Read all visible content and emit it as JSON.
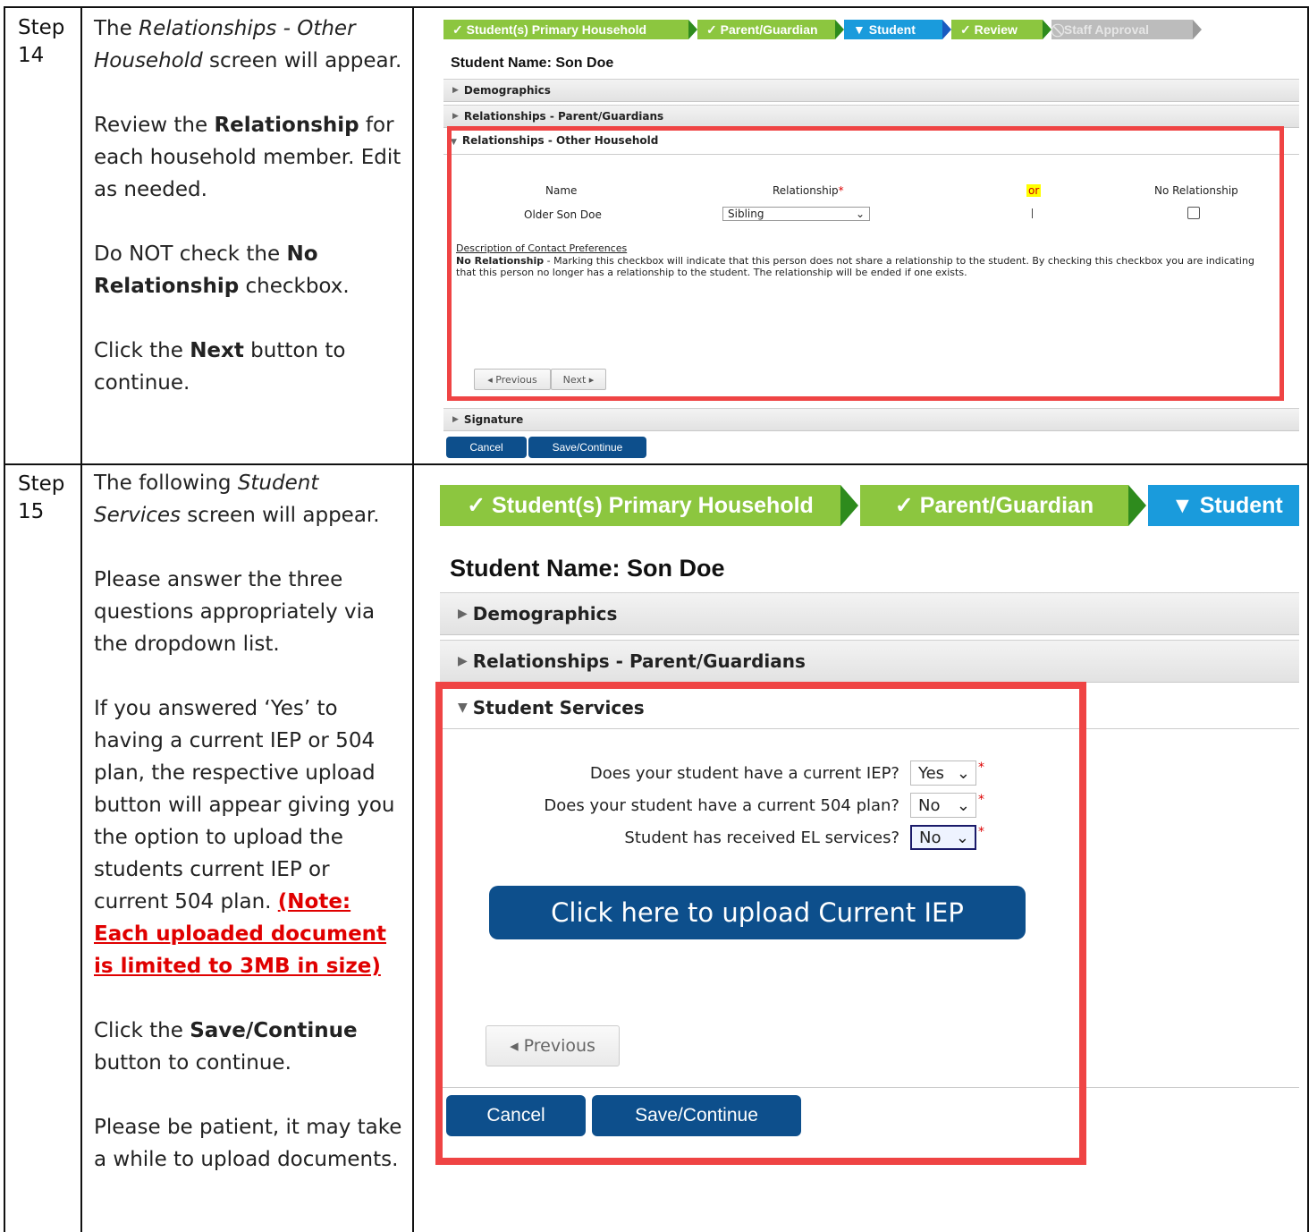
{
  "step14": {
    "label": "Step 14",
    "instruction": {
      "p1_lead": "The ",
      "p1_italic": "Relationships - Other Household",
      "p1_tail": " screen will appear.",
      "p2_lead": "Review the ",
      "p2_bold": "Relationship",
      "p2_tail": " for each household member. Edit as needed.",
      "p3_lead": "Do NOT check the ",
      "p3_bold": "No Relationship",
      "p3_tail": " checkbox.",
      "p4_lead": "Click the ",
      "p4_bold": "Next",
      "p4_tail": " button to continue."
    },
    "screenshot": {
      "crumbs": [
        "✓ Student(s) Primary Household",
        "✓ Parent/Guardian",
        "▼ Student",
        "✓ Review",
        "⃠ Staff Approval"
      ],
      "student_name": "Student Name: Son Doe",
      "sections": {
        "demographics": "Demographics",
        "relationships_parents": "Relationships - Parent/Guardians",
        "relationships_other": "Relationships - Other Household",
        "signature": "Signature"
      },
      "columns": {
        "name": "Name",
        "relationship": "Relationship",
        "or": "or",
        "no_relationship": "No Relationship"
      },
      "row": {
        "name": "Older Son Doe",
        "relationship": "Sibling"
      },
      "desc_title": "Description of Contact Preferences",
      "desc_bold": "No Relationship",
      "desc_text": " - Marking this checkbox will indicate that this person does not share a relationship to the student. By checking this checkbox you are indicating that this person no longer has a relationship to the student. The relationship will be ended if one exists.",
      "previous": "◂ Previous",
      "next": "Next ▸",
      "cancel": "Cancel",
      "save_continue": "Save/Continue"
    }
  },
  "step15": {
    "label": "Step 15",
    "instruction": {
      "p1_lead": "The following ",
      "p1_italic": "Student Services",
      "p1_tail": " screen will appear.",
      "p2": "Please answer the three questions appropriately via the dropdown list.",
      "p3": "If you answered ‘Yes’ to having a current IEP or 504 plan, the respective upload button will appear giving you the option to upload the students current IEP or current 504 plan. ",
      "p3_note": "(Note: Each uploaded document is limited to 3MB in size)",
      "p4_lead": "Click the ",
      "p4_bold": "Save/Continue",
      "p4_tail": " button to continue.",
      "p5": "Please be patient, it may take a while to upload documents."
    },
    "screenshot": {
      "crumbs": [
        "✓ Student(s) Primary Household",
        "✓ Parent/Guardian",
        "▼ Student"
      ],
      "student_name": "Student Name: Son Doe",
      "sections": {
        "demographics": "Demographics",
        "relationships_parents": "Relationships - Parent/Guardians",
        "student_services": "Student Services"
      },
      "questions": [
        {
          "text": "Does your student have a current IEP?",
          "value": "Yes"
        },
        {
          "text": "Does your student have a current 504 plan?",
          "value": "No"
        },
        {
          "text": "Student has received EL services?",
          "value": "No"
        }
      ],
      "upload_label": "Click here to upload Current IEP",
      "previous": "◂ Previous",
      "cancel": "Cancel",
      "save_continue": "Save/Continue"
    }
  },
  "colors": {
    "highlight_box": "#ef4444",
    "green_crumb": "#8cc63f",
    "blue_crumb": "#1a9bdc",
    "button_blue": "#0d4f8c"
  }
}
